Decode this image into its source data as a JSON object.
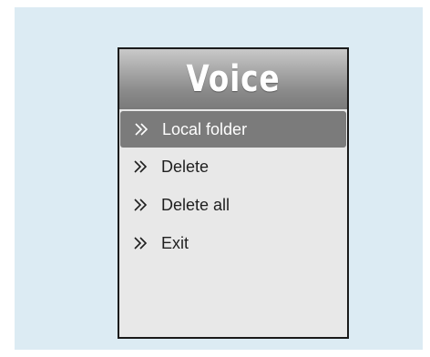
{
  "screen": {
    "title": "Voice",
    "menu": [
      {
        "label": "Local folder",
        "icon": "double-chevron-right-icon",
        "selected": true
      },
      {
        "label": "Delete",
        "icon": "double-chevron-right-icon",
        "selected": false
      },
      {
        "label": "Delete all",
        "icon": "double-chevron-right-icon",
        "selected": false
      },
      {
        "label": "Exit",
        "icon": "double-chevron-right-icon",
        "selected": false
      }
    ]
  },
  "colors": {
    "backdrop": "#dcebf3",
    "screen_bg": "#e8e8e8",
    "selected_bg": "#7b7b7b",
    "title_text": "#ffffff"
  }
}
